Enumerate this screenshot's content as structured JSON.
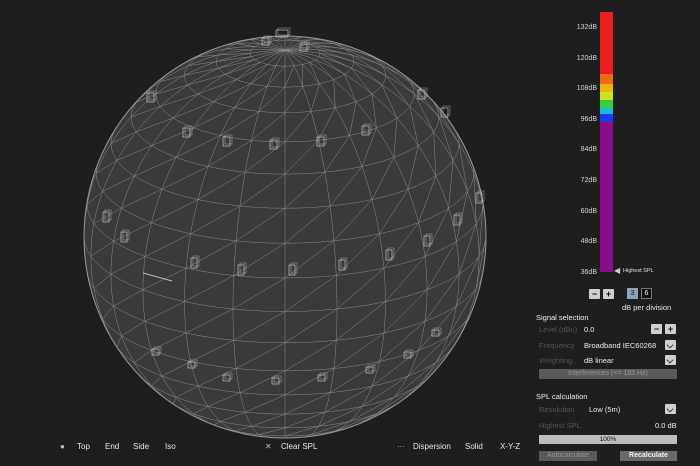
{
  "colors": {
    "background": "#1e1e1e",
    "sphere_fill": "#3a3a3a",
    "wire": "#8c8c8c",
    "purple": "#8b0d8b"
  },
  "colorbar": {
    "ticks": [
      "132dB",
      "120dB",
      "108dB",
      "96dB",
      "84dB",
      "72dB",
      "60dB",
      "48dB",
      "36dB"
    ],
    "marker_label": "Highest SPL"
  },
  "divisions": {
    "minus": "−",
    "plus": "+",
    "options": [
      "3",
      "6"
    ],
    "selected": "3",
    "label": "dB per division"
  },
  "signal": {
    "title": "Signal selection",
    "level_label": "Level (dBu)",
    "level_value": "0.0",
    "frequency_label": "Frequency",
    "frequency_value": "Broadband IEC60268",
    "weighting_label": "Weighting",
    "weighting_value": "dB linear",
    "interferences_button": "Interferences (<= 183 Hz)"
  },
  "spl": {
    "title": "SPL calculation",
    "resolution_label": "Resolution",
    "resolution_value": "Low (5m)",
    "highest_label": "Highest SPL",
    "highest_value": "0.0 dB",
    "progress_label": "100%",
    "progress": 1.0,
    "autocalculate": "Autocalculate",
    "recalculate": "Recalculate"
  },
  "bottom": {
    "views": [
      "Top",
      "End",
      "Side",
      "Iso"
    ],
    "clear": "Clear SPL",
    "modes": [
      "Dispersion",
      "Solid",
      "X-Y-Z"
    ]
  }
}
